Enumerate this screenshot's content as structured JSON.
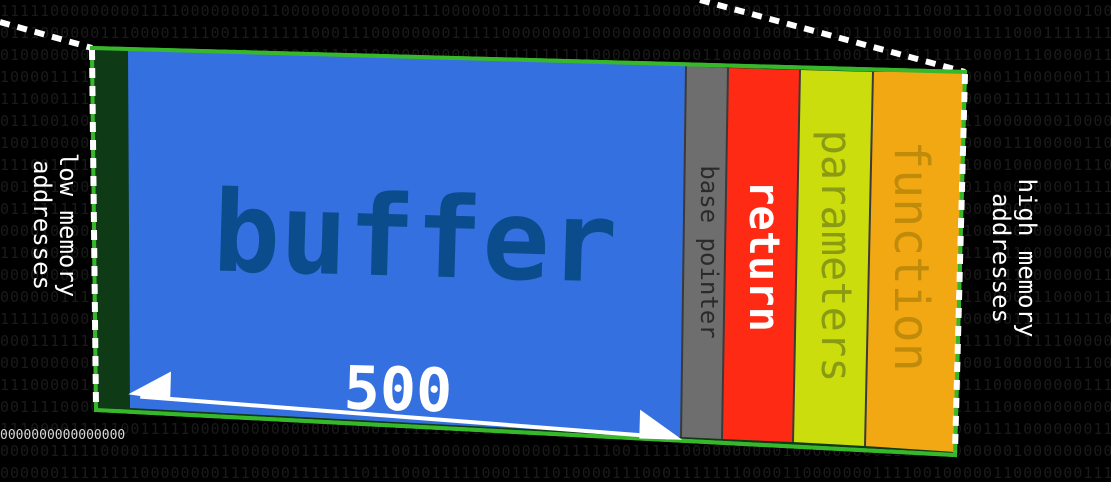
{
  "segments": {
    "buffer": {
      "label": "buffer",
      "color": "#3570E0",
      "text_color": "#0B4C8C"
    },
    "base_pointer": {
      "label": "base pointer",
      "color": "#6E6E6E",
      "text_color": "#2A2A2A"
    },
    "return": {
      "label": "return",
      "color": "#FF2A14",
      "text_color": "#FFFFFF"
    },
    "parameters": {
      "label": "parameters",
      "color": "#CCDD0E",
      "text_color": "#8A9A12"
    },
    "function": {
      "label": "function",
      "color": "#F2A813",
      "text_color": "#C08A0A"
    }
  },
  "buffer_size": {
    "label": "500",
    "color": "#FFFFFF"
  },
  "axis": {
    "low": {
      "line1": "low memory",
      "line2": "addresses"
    },
    "high": {
      "line1": "high memory",
      "line2": "addresses"
    }
  },
  "edge_bits": "0000000000000000",
  "colors": {
    "frame_border": "#37B82B",
    "left_strip": "#0E3A16",
    "dotted_line": "#FFFFFF",
    "background": "#000000",
    "background_binary": "#1A1A1A"
  }
}
